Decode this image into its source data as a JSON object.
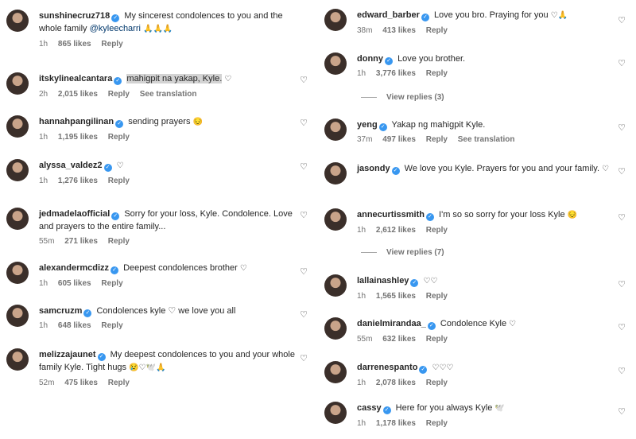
{
  "left": [
    {
      "user": "sunshinecruz718",
      "text": "My sincerest condolences to you and the whole family",
      "mention": "@kyleecharri",
      "emoji": "🙏🙏🙏",
      "time": "1h",
      "likes": "865 likes",
      "reply": "Reply"
    },
    {
      "user": "itskylinealcantara",
      "text": "mahigpit na yakap, Kyle.",
      "emoji": "♡",
      "time": "2h",
      "likes": "2,015 likes",
      "reply": "Reply",
      "see_translation": "See translation"
    },
    {
      "user": "hannahpangilinan",
      "text": "sending prayers",
      "emoji": "😔",
      "time": "1h",
      "likes": "1,195 likes",
      "reply": "Reply"
    },
    {
      "user": "alyssa_valdez2",
      "text": "",
      "emoji": "♡",
      "time": "1h",
      "likes": "1,276 likes",
      "reply": "Reply"
    },
    {
      "user": "jedmadelaofficial",
      "text": "Sorry for your loss, Kyle. Condolence. Love and prayers to the entire family...",
      "emoji": "",
      "time": "55m",
      "likes": "271 likes",
      "reply": "Reply"
    },
    {
      "user": "alexandermcdizz",
      "text": "Deepest condolences brother",
      "emoji": "♡",
      "time": "1h",
      "likes": "605 likes",
      "reply": "Reply"
    },
    {
      "user": "samcruzm",
      "text": "Condolences kyle ♡ we love you all",
      "emoji": "",
      "time": "1h",
      "likes": "648 likes",
      "reply": "Reply"
    },
    {
      "user": "melizzajaunet",
      "text": "My deepest condolences to you and your whole family Kyle. Tight hugs",
      "emoji": "😢♡🕊️🙏",
      "time": "52m",
      "likes": "475 likes",
      "reply": "Reply"
    }
  ],
  "right": [
    {
      "user": "edward_barber",
      "text": "Love you bro. Praying for you",
      "emoji": "♡🙏",
      "time": "38m",
      "likes": "413 likes",
      "reply": "Reply"
    },
    {
      "user": "donny",
      "text": "Love you brother.",
      "emoji": "",
      "time": "1h",
      "likes": "3,776 likes",
      "reply": "Reply",
      "view_replies": "View replies (3)"
    },
    {
      "user": "yeng",
      "text": "Yakap ng mahigpit Kyle.",
      "emoji": "",
      "time": "37m",
      "likes": "497 likes",
      "reply": "Reply",
      "see_translation": "See translation"
    },
    {
      "user": "jasondy",
      "text": "We love you Kyle. Prayers for you and your family.",
      "emoji": "♡",
      "time": "",
      "likes": "",
      "reply": ""
    },
    {
      "user": "annecurtissmith",
      "text": "I'm so so sorry for your loss Kyle",
      "emoji": "😔",
      "time": "1h",
      "likes": "2,612 likes",
      "reply": "Reply",
      "view_replies": "View replies (7)"
    },
    {
      "user": "lallainashley",
      "text": "",
      "emoji": "♡♡",
      "time": "1h",
      "likes": "1,565 likes",
      "reply": "Reply"
    },
    {
      "user": "danielmirandaa_",
      "text": "Condolence Kyle",
      "emoji": "♡",
      "time": "55m",
      "likes": "632 likes",
      "reply": "Reply"
    },
    {
      "user": "darrenespanto",
      "text": "",
      "emoji": "♡♡♡",
      "time": "1h",
      "likes": "2,078 likes",
      "reply": "Reply"
    },
    {
      "user": "cassy",
      "text": "Here for you always Kyle",
      "emoji": "🕊️",
      "time": "1h",
      "likes": "1,178 likes",
      "reply": "Reply"
    }
  ],
  "icons": {
    "like": "heart-outline-icon",
    "verified": "verified-badge-icon"
  },
  "colors": {
    "verified": "#3897f0",
    "muted": "#737373",
    "mention": "#00376b"
  }
}
